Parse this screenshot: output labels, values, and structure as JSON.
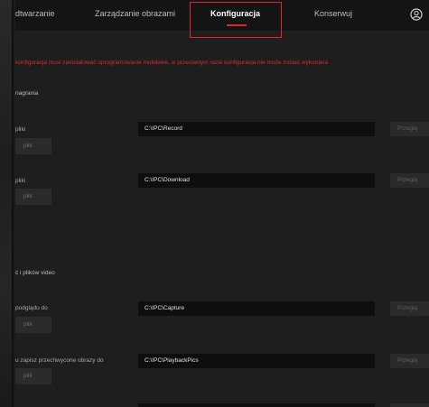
{
  "nav": {
    "tabs": [
      {
        "label": "dtwarzanie"
      },
      {
        "label": "Zarządzanie obrazami"
      },
      {
        "label": "Konfiguracja"
      },
      {
        "label": "Konserwuj"
      }
    ],
    "active_tab": "Konfiguracja",
    "user_icon": "user-circle-icon"
  },
  "warning": "konfiguracja musi zainstalować oprogramowanie mobilowe, w przeciwnym razie konfiguracja nie może zostać wykonana",
  "sections": [
    {
      "title": "nagrania"
    },
    {
      "title": "ć i plików video"
    }
  ],
  "rows": [
    {
      "label": "pliki",
      "path": "C:\\IPC\\Record",
      "browse": "Przeglą",
      "open": "plik"
    },
    {
      "label": "pliki",
      "path": "C:\\IPC\\Download",
      "browse": "Przeglą",
      "open": "plik"
    },
    {
      "label": "podglądu do",
      "path": "C:\\IPC\\Capture",
      "browse": "Przeglą",
      "open": "plik"
    },
    {
      "label": "u zapisz przechwycone obrazy do",
      "path": "C:\\IPC\\PlaybackPics",
      "browse": "Przeglą",
      "open": "plik"
    }
  ],
  "colors": {
    "accent": "#e0262b",
    "warning": "#d62b2b",
    "background": "#1e1e1e",
    "nav_background": "#141414"
  }
}
